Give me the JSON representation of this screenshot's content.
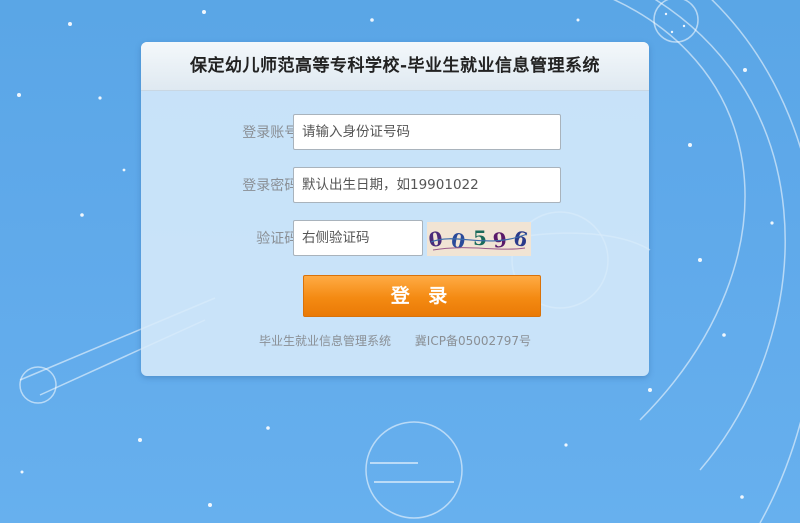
{
  "title": "保定幼儿师范高等专科学校-毕业生就业信息管理系统",
  "form": {
    "account_label": "登录账号:",
    "account_placeholder": "请输入身份证号码",
    "password_label": "登录密码:",
    "password_placeholder": "默认出生日期，如19901022",
    "captcha_label": "验证码:",
    "captcha_placeholder": "右侧验证码",
    "captcha_digits": [
      "0",
      "0",
      "5",
      "9",
      "6"
    ]
  },
  "login_button": "登 录",
  "footer": {
    "system_name": "毕业生就业信息管理系统",
    "icp": "冀ICP备05002797号"
  },
  "colors": {
    "background": "#5fa9ea",
    "button": "#f48a12"
  }
}
